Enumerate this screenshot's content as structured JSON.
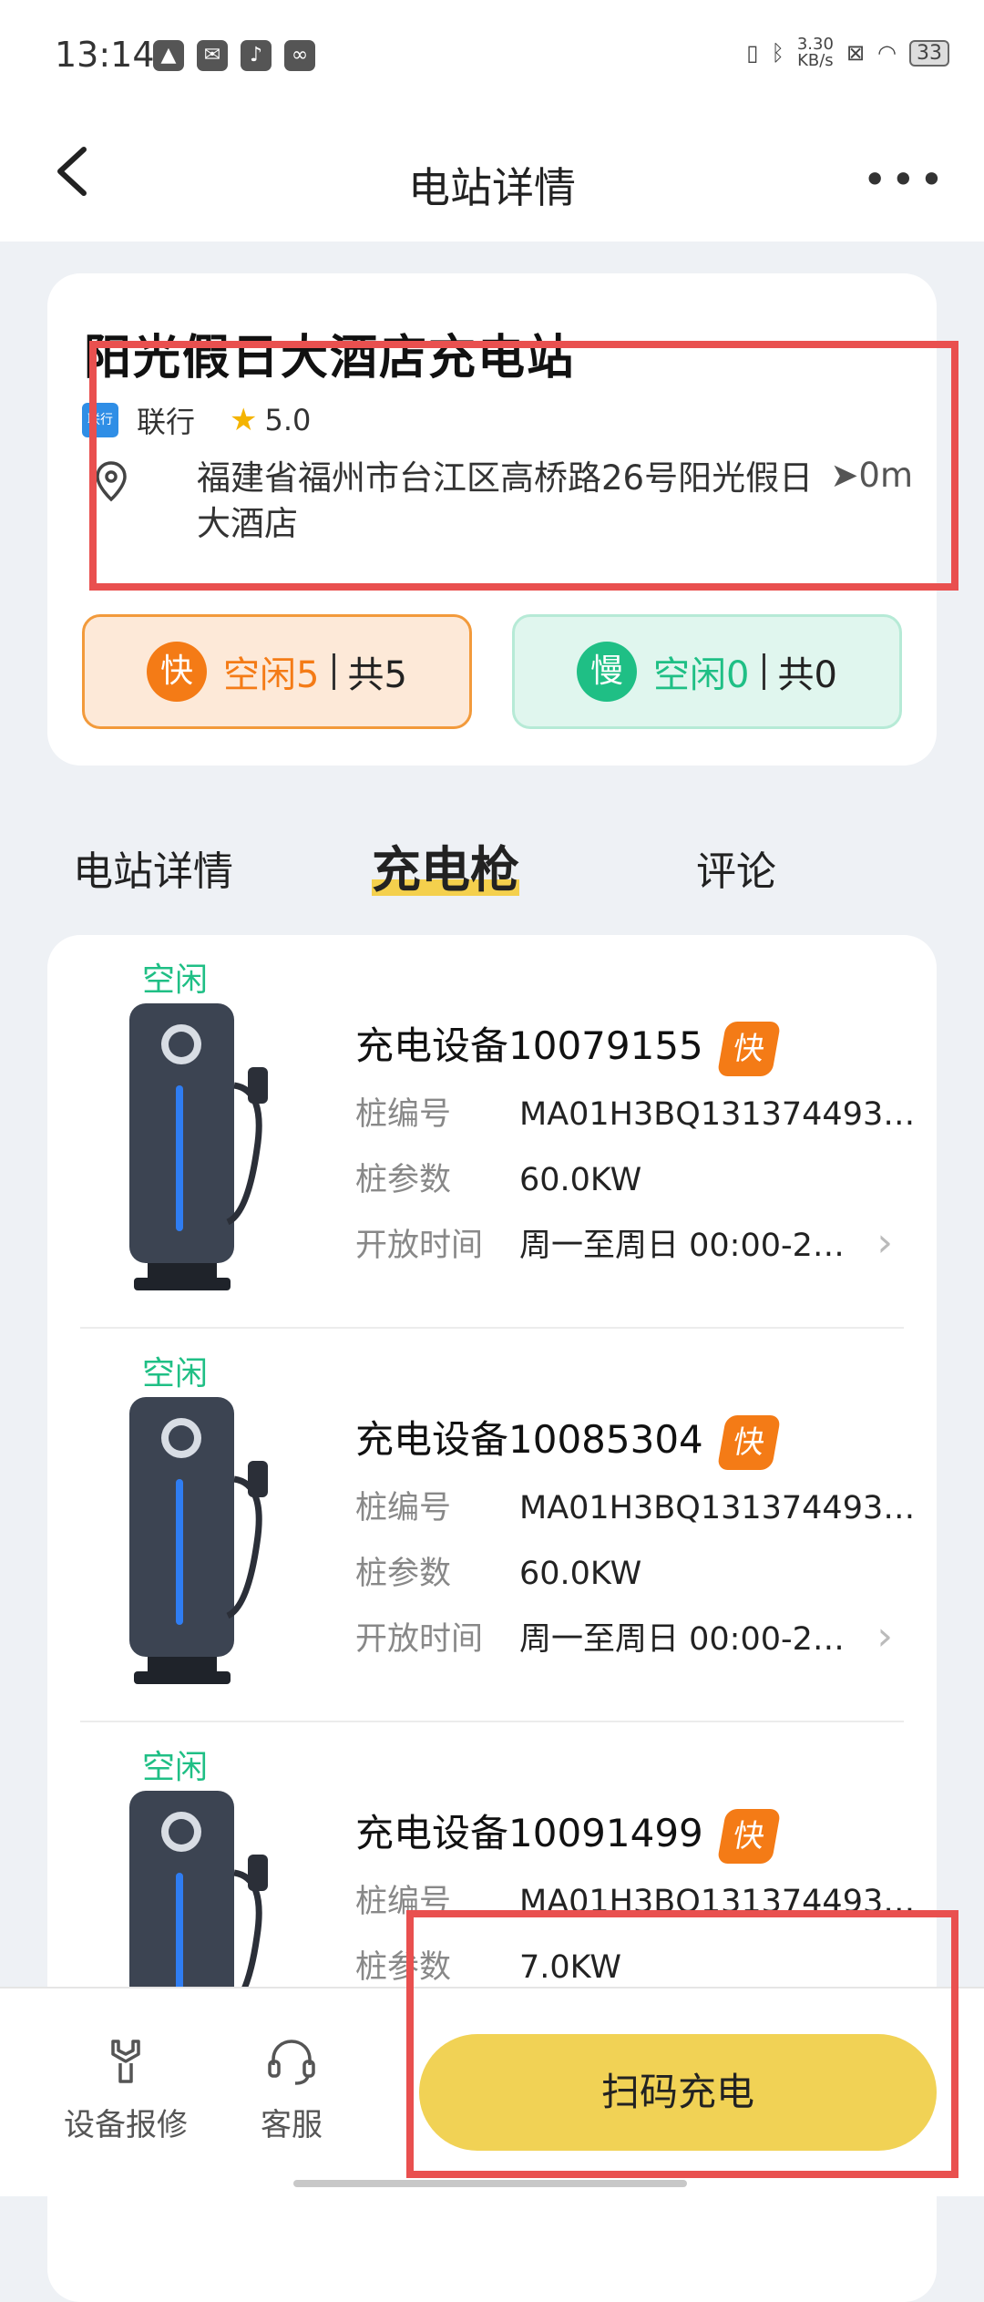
{
  "status_bar": {
    "time": "13:14",
    "speed": "3.30",
    "speed_unit": "KB/s",
    "battery": "33"
  },
  "nav": {
    "title": "电站详情",
    "more": "•••"
  },
  "station": {
    "name": "阳光假日大酒店充电站",
    "operator": "联行",
    "operator_logo": "联行",
    "rating": "5.0",
    "address": "福建省福州市台江区高桥路26号阳光假日大酒店",
    "distance": "0m"
  },
  "availability": {
    "fast": {
      "badge": "快",
      "free": "空闲5",
      "total": "共5"
    },
    "slow": {
      "badge": "慢",
      "free": "空闲0",
      "total": "共0"
    }
  },
  "tabs": [
    "电站详情",
    "充电枪",
    "评论"
  ],
  "labels": {
    "pile_no": "桩编号",
    "pile_param": "桩参数",
    "open_time": "开放时间"
  },
  "piles": [
    {
      "status": "空闲",
      "name": "充电设备10079155",
      "tag": "快",
      "pile_no": "MA01H3BQ131374493…",
      "param": "60.0KW",
      "open_time": "周一至周日 00:00-2…"
    },
    {
      "status": "空闲",
      "name": "充电设备10085304",
      "tag": "快",
      "pile_no": "MA01H3BQ131374493…",
      "param": "60.0KW",
      "open_time": "周一至周日 00:00-2…"
    },
    {
      "status": "空闲",
      "name": "充电设备10091499",
      "tag": "快",
      "pile_no": "MA01H3BQ131374493…",
      "param": "7.0KW",
      "open_time": ""
    }
  ],
  "bottom": {
    "repair": "设备报修",
    "service": "客服",
    "scan": "扫码充电"
  },
  "colors": {
    "accent_yellow": "#f1d255",
    "fast_orange": "#f47b16",
    "free_green": "#1fbf85",
    "highlight_red": "#e9504f"
  }
}
